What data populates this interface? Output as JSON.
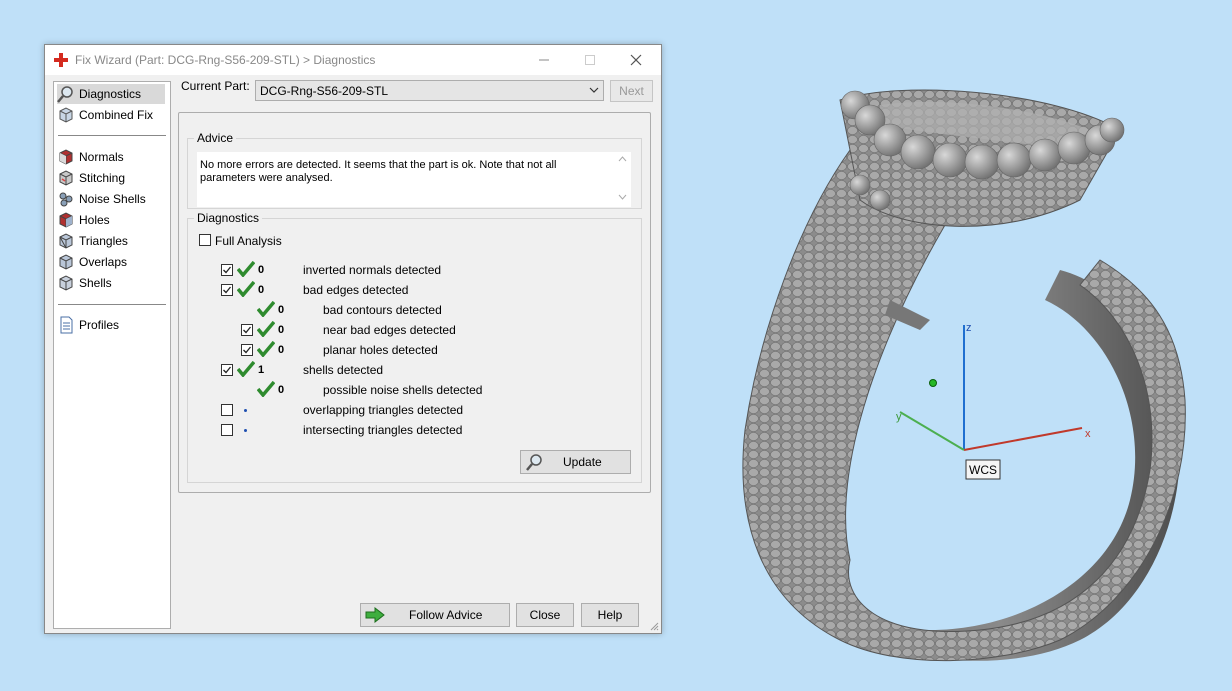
{
  "dialog": {
    "title": "Fix Wizard (Part: DCG-Rng-S56-209-STL) > Diagnostics"
  },
  "sidebar": {
    "items": [
      {
        "label": "Diagnostics",
        "icon": "magnifier-icon"
      },
      {
        "label": "Combined Fix",
        "icon": "combined-fix-icon"
      },
      {
        "label": "Normals",
        "icon": "normals-cube-icon"
      },
      {
        "label": "Stitching",
        "icon": "stitching-cube-icon"
      },
      {
        "label": "Noise Shells",
        "icon": "noise-shells-icon"
      },
      {
        "label": "Holes",
        "icon": "holes-cube-icon"
      },
      {
        "label": "Triangles",
        "icon": "triangles-cube-icon"
      },
      {
        "label": "Overlaps",
        "icon": "overlaps-cube-icon"
      },
      {
        "label": "Shells",
        "icon": "shells-cube-icon"
      },
      {
        "label": "Profiles",
        "icon": "profiles-document-icon"
      }
    ]
  },
  "current_part": {
    "label": "Current Part:",
    "value": "DCG-Rng-S56-209-STL",
    "next_label": "Next"
  },
  "advice": {
    "title": "Advice",
    "text": "No more errors are detected. It seems that the part is ok. Note that not all parameters were analysed."
  },
  "diagnostics": {
    "title": "Diagnostics",
    "full_analysis_label": "Full Analysis",
    "rows": [
      {
        "checkbox": "checked",
        "status": "ok",
        "count": "0",
        "label": "inverted normals detected"
      },
      {
        "checkbox": "checked",
        "status": "ok",
        "count": "0",
        "label": "bad edges detected"
      },
      {
        "checkbox": "none",
        "status": "ok",
        "count": "0",
        "label": "bad contours detected"
      },
      {
        "checkbox": "checked",
        "status": "ok",
        "count": "0",
        "label": "near bad edges detected"
      },
      {
        "checkbox": "checked",
        "status": "ok",
        "count": "0",
        "label": "planar holes detected"
      },
      {
        "checkbox": "checked",
        "status": "ok",
        "count": "1",
        "label": "shells detected"
      },
      {
        "checkbox": "none",
        "status": "ok",
        "count": "0",
        "label": "possible noise shells detected"
      },
      {
        "checkbox": "unchecked",
        "status": "not-run",
        "count": "",
        "label": "overlapping triangles detected"
      },
      {
        "checkbox": "unchecked",
        "status": "not-run",
        "count": "",
        "label": "intersecting triangles detected"
      }
    ],
    "update_label": "Update"
  },
  "footer": {
    "follow_advice_label": "Follow Advice",
    "close_label": "Close",
    "help_label": "Help"
  },
  "viewport": {
    "axis_x": "x",
    "axis_y": "y",
    "axis_z": "z",
    "wcs_label": "WCS"
  },
  "colors": {
    "background": "#bfe0f8",
    "check_green": "#2e8b2e",
    "axis_x": "#c0392b",
    "axis_y": "#4caf50",
    "axis_z": "#1f6fd0"
  }
}
